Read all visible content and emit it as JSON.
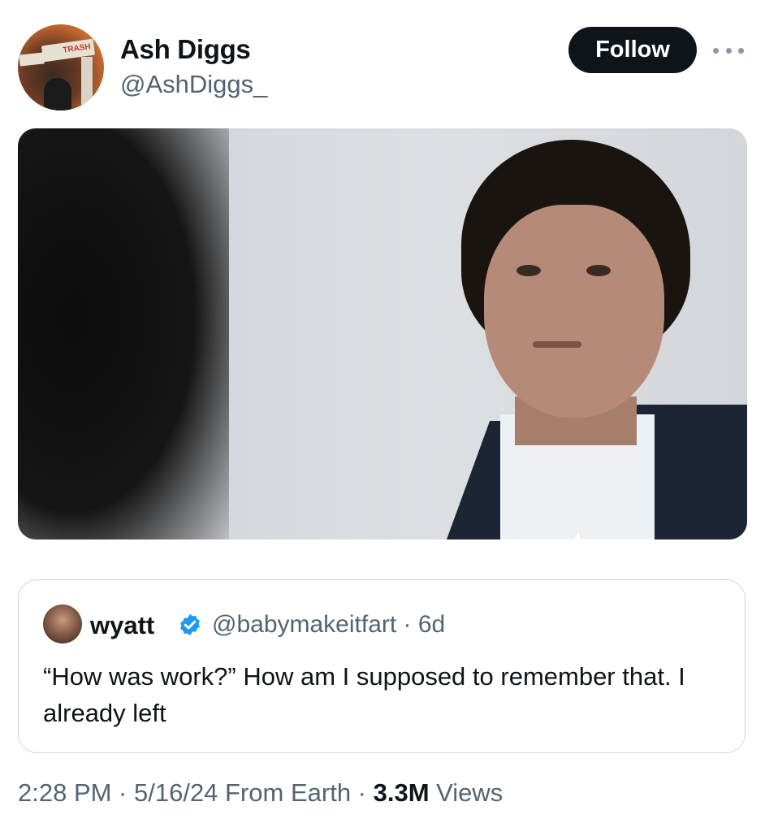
{
  "author": {
    "display_name": "Ash Diggs",
    "handle": "@AshDiggs_",
    "avatar_sign_text": "TRASH"
  },
  "follow_label": "Follow",
  "more_icon": "more-horizontal-icon",
  "quoted_tweet": {
    "name": "wyatt",
    "verified": true,
    "handle_and_time": "@babymakeitfart · 6d",
    "text": "“How was work?” How am I supposed to remember that. I already left"
  },
  "meta": {
    "time_date": "2:28 PM · 5/16/24 From Earth · ",
    "views_count": "3.3M",
    "views_label": " Views"
  },
  "colors": {
    "primary_text": "#0f1419",
    "secondary_text": "#536471",
    "verified_blue": "#1d9bf0",
    "border": "#cfd9de"
  }
}
